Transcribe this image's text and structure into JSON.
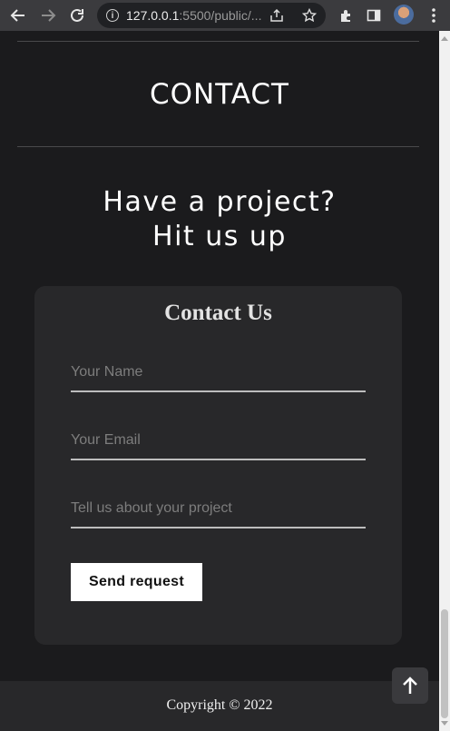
{
  "browser": {
    "url_host": "127.0.0.1",
    "url_path": ":5500/public/...",
    "back_icon": "arrow-left-icon",
    "forward_icon": "arrow-right-icon",
    "reload_icon": "reload-icon"
  },
  "page": {
    "section_title": "CONTACT",
    "headline_line1": "Have a project?",
    "headline_line2": "Hit us up",
    "form": {
      "title": "Contact Us",
      "name_placeholder": "Your Name",
      "email_placeholder": "Your Email",
      "project_placeholder": "Tell us about your project",
      "submit_label": "Send request"
    },
    "footer": {
      "copyright": "Copyright © 2022"
    }
  },
  "colors": {
    "background": "#1b1b1d",
    "card": "#28282a",
    "text": "#ffffff"
  }
}
